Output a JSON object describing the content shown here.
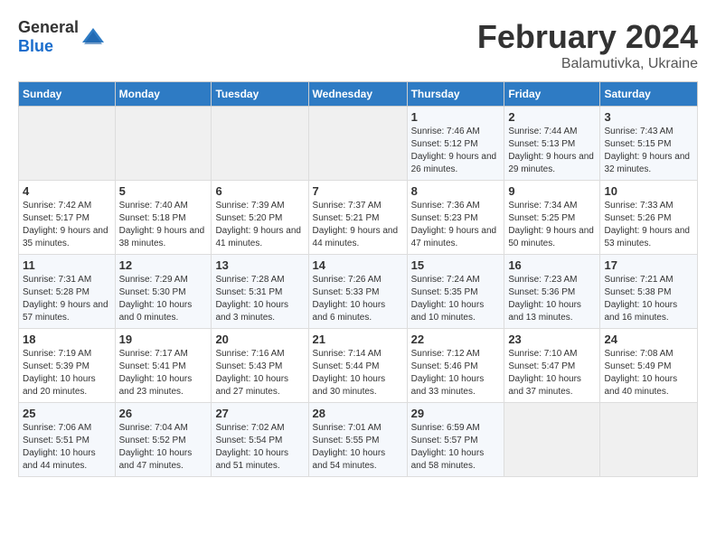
{
  "header": {
    "logo_general": "General",
    "logo_blue": "Blue",
    "title": "February 2024",
    "location": "Balamutivka, Ukraine"
  },
  "days_of_week": [
    "Sunday",
    "Monday",
    "Tuesday",
    "Wednesday",
    "Thursday",
    "Friday",
    "Saturday"
  ],
  "weeks": [
    [
      {
        "day": "",
        "sunrise": "",
        "sunset": "",
        "daylight": ""
      },
      {
        "day": "",
        "sunrise": "",
        "sunset": "",
        "daylight": ""
      },
      {
        "day": "",
        "sunrise": "",
        "sunset": "",
        "daylight": ""
      },
      {
        "day": "",
        "sunrise": "",
        "sunset": "",
        "daylight": ""
      },
      {
        "day": "1",
        "sunrise": "Sunrise: 7:46 AM",
        "sunset": "Sunset: 5:12 PM",
        "daylight": "Daylight: 9 hours and 26 minutes."
      },
      {
        "day": "2",
        "sunrise": "Sunrise: 7:44 AM",
        "sunset": "Sunset: 5:13 PM",
        "daylight": "Daylight: 9 hours and 29 minutes."
      },
      {
        "day": "3",
        "sunrise": "Sunrise: 7:43 AM",
        "sunset": "Sunset: 5:15 PM",
        "daylight": "Daylight: 9 hours and 32 minutes."
      }
    ],
    [
      {
        "day": "4",
        "sunrise": "Sunrise: 7:42 AM",
        "sunset": "Sunset: 5:17 PM",
        "daylight": "Daylight: 9 hours and 35 minutes."
      },
      {
        "day": "5",
        "sunrise": "Sunrise: 7:40 AM",
        "sunset": "Sunset: 5:18 PM",
        "daylight": "Daylight: 9 hours and 38 minutes."
      },
      {
        "day": "6",
        "sunrise": "Sunrise: 7:39 AM",
        "sunset": "Sunset: 5:20 PM",
        "daylight": "Daylight: 9 hours and 41 minutes."
      },
      {
        "day": "7",
        "sunrise": "Sunrise: 7:37 AM",
        "sunset": "Sunset: 5:21 PM",
        "daylight": "Daylight: 9 hours and 44 minutes."
      },
      {
        "day": "8",
        "sunrise": "Sunrise: 7:36 AM",
        "sunset": "Sunset: 5:23 PM",
        "daylight": "Daylight: 9 hours and 47 minutes."
      },
      {
        "day": "9",
        "sunrise": "Sunrise: 7:34 AM",
        "sunset": "Sunset: 5:25 PM",
        "daylight": "Daylight: 9 hours and 50 minutes."
      },
      {
        "day": "10",
        "sunrise": "Sunrise: 7:33 AM",
        "sunset": "Sunset: 5:26 PM",
        "daylight": "Daylight: 9 hours and 53 minutes."
      }
    ],
    [
      {
        "day": "11",
        "sunrise": "Sunrise: 7:31 AM",
        "sunset": "Sunset: 5:28 PM",
        "daylight": "Daylight: 9 hours and 57 minutes."
      },
      {
        "day": "12",
        "sunrise": "Sunrise: 7:29 AM",
        "sunset": "Sunset: 5:30 PM",
        "daylight": "Daylight: 10 hours and 0 minutes."
      },
      {
        "day": "13",
        "sunrise": "Sunrise: 7:28 AM",
        "sunset": "Sunset: 5:31 PM",
        "daylight": "Daylight: 10 hours and 3 minutes."
      },
      {
        "day": "14",
        "sunrise": "Sunrise: 7:26 AM",
        "sunset": "Sunset: 5:33 PM",
        "daylight": "Daylight: 10 hours and 6 minutes."
      },
      {
        "day": "15",
        "sunrise": "Sunrise: 7:24 AM",
        "sunset": "Sunset: 5:35 PM",
        "daylight": "Daylight: 10 hours and 10 minutes."
      },
      {
        "day": "16",
        "sunrise": "Sunrise: 7:23 AM",
        "sunset": "Sunset: 5:36 PM",
        "daylight": "Daylight: 10 hours and 13 minutes."
      },
      {
        "day": "17",
        "sunrise": "Sunrise: 7:21 AM",
        "sunset": "Sunset: 5:38 PM",
        "daylight": "Daylight: 10 hours and 16 minutes."
      }
    ],
    [
      {
        "day": "18",
        "sunrise": "Sunrise: 7:19 AM",
        "sunset": "Sunset: 5:39 PM",
        "daylight": "Daylight: 10 hours and 20 minutes."
      },
      {
        "day": "19",
        "sunrise": "Sunrise: 7:17 AM",
        "sunset": "Sunset: 5:41 PM",
        "daylight": "Daylight: 10 hours and 23 minutes."
      },
      {
        "day": "20",
        "sunrise": "Sunrise: 7:16 AM",
        "sunset": "Sunset: 5:43 PM",
        "daylight": "Daylight: 10 hours and 27 minutes."
      },
      {
        "day": "21",
        "sunrise": "Sunrise: 7:14 AM",
        "sunset": "Sunset: 5:44 PM",
        "daylight": "Daylight: 10 hours and 30 minutes."
      },
      {
        "day": "22",
        "sunrise": "Sunrise: 7:12 AM",
        "sunset": "Sunset: 5:46 PM",
        "daylight": "Daylight: 10 hours and 33 minutes."
      },
      {
        "day": "23",
        "sunrise": "Sunrise: 7:10 AM",
        "sunset": "Sunset: 5:47 PM",
        "daylight": "Daylight: 10 hours and 37 minutes."
      },
      {
        "day": "24",
        "sunrise": "Sunrise: 7:08 AM",
        "sunset": "Sunset: 5:49 PM",
        "daylight": "Daylight: 10 hours and 40 minutes."
      }
    ],
    [
      {
        "day": "25",
        "sunrise": "Sunrise: 7:06 AM",
        "sunset": "Sunset: 5:51 PM",
        "daylight": "Daylight: 10 hours and 44 minutes."
      },
      {
        "day": "26",
        "sunrise": "Sunrise: 7:04 AM",
        "sunset": "Sunset: 5:52 PM",
        "daylight": "Daylight: 10 hours and 47 minutes."
      },
      {
        "day": "27",
        "sunrise": "Sunrise: 7:02 AM",
        "sunset": "Sunset: 5:54 PM",
        "daylight": "Daylight: 10 hours and 51 minutes."
      },
      {
        "day": "28",
        "sunrise": "Sunrise: 7:01 AM",
        "sunset": "Sunset: 5:55 PM",
        "daylight": "Daylight: 10 hours and 54 minutes."
      },
      {
        "day": "29",
        "sunrise": "Sunrise: 6:59 AM",
        "sunset": "Sunset: 5:57 PM",
        "daylight": "Daylight: 10 hours and 58 minutes."
      },
      {
        "day": "",
        "sunrise": "",
        "sunset": "",
        "daylight": ""
      },
      {
        "day": "",
        "sunrise": "",
        "sunset": "",
        "daylight": ""
      }
    ]
  ]
}
